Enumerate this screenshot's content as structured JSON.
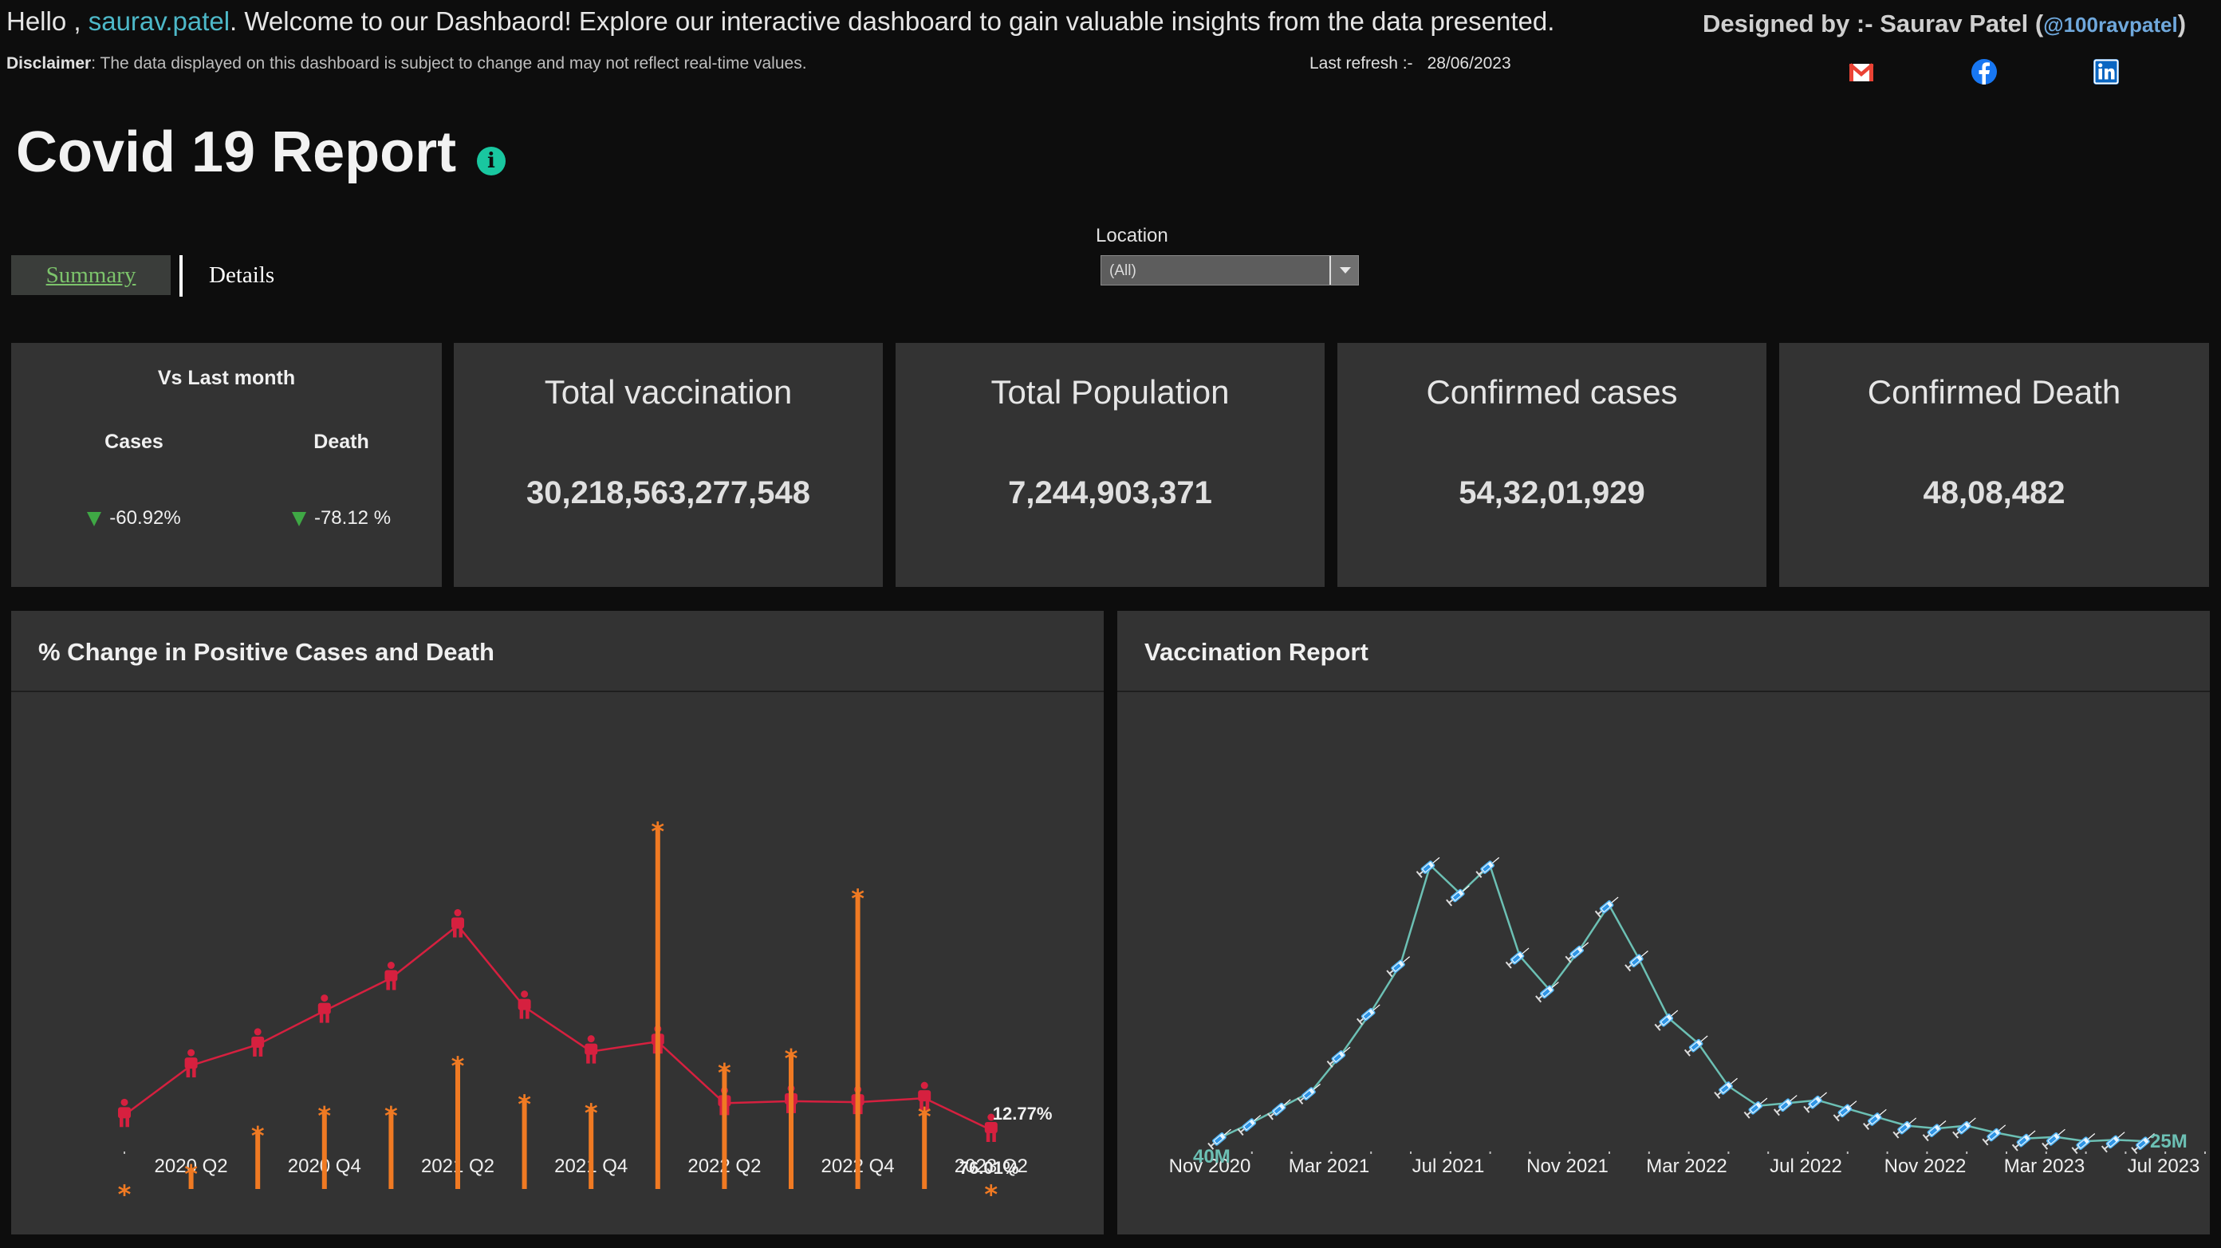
{
  "header": {
    "greeting_prefix": "Hello ,",
    "username": "saurav.patel",
    "greeting_suffix": ".  Welcome to our Dashbaord! Explore our interactive dashboard to gain valuable insights from the data presented.",
    "disclaimer_label": "Disclaimer",
    "disclaimer_text": ": The data displayed on this dashboard is subject to change and may not reflect real-time values.",
    "refresh_label": "Last refresh :-",
    "refresh_date": "28/06/2023",
    "designer_label": "Designed by  :- Saurav Patel (",
    "designer_handle": "@100ravpatel",
    "designer_close": ")",
    "social_icons": [
      "gmail-icon",
      "facebook-icon",
      "linkedin-icon"
    ],
    "colors": {
      "gmail": "#ea4335",
      "facebook": "#1877f2",
      "linkedin": "#0a66c2"
    }
  },
  "title": "Covid 19 Report",
  "info_icon": "i",
  "tabs": [
    {
      "label": "Summary",
      "active": true
    },
    {
      "label": "Details",
      "active": false
    }
  ],
  "filter": {
    "label": "Location",
    "value": "(All)"
  },
  "kpis": {
    "vs_title": "Vs Last month",
    "cases_label": "Cases",
    "death_label": "Death",
    "cases_change": "-60.92%",
    "death_change": "-78.12 %",
    "cards": [
      {
        "title": "Total vaccination",
        "value": "30,218,563,277,548"
      },
      {
        "title": "Total Population",
        "value": "7,244,903,371"
      },
      {
        "title": "Confirmed cases",
        "value": "54,32,01,929"
      },
      {
        "title": "Confirmed Death",
        "value": "48,08,482"
      }
    ]
  },
  "panels": {
    "left_title": "% Change in Positive Cases and Death",
    "right_title": "Vaccination Report"
  },
  "chart_data": [
    {
      "type": "line",
      "title": "% Change in Positive Cases and Death",
      "x": [
        "2020 Q1",
        "2020 Q2",
        "2020 Q3",
        "2020 Q4",
        "2021 Q1",
        "2021 Q2",
        "2021 Q3",
        "2021 Q4",
        "2022 Q1",
        "2022 Q2",
        "2022 Q3",
        "2022 Q4",
        "2023 Q1",
        "2023 Q2"
      ],
      "tick_labels": [
        "2020 Q2",
        "2020 Q4",
        "2021 Q2",
        "2021 Q4",
        "2022 Q2",
        "2022 Q4",
        "2023 Q2"
      ],
      "series": [
        {
          "kind": "line",
          "color": "#d6203f",
          "values": [
            1.5,
            6.5,
            8.6,
            12.0,
            15.3,
            20.6,
            12.4,
            7.9,
            8.9,
            2.7,
            2.9,
            2.8,
            3.2,
            0.0
          ],
          "end_label": "12.77%"
        },
        {
          "kind": "lollipop",
          "color": "#f07a23",
          "values": [
            0.1,
            2.2,
            6.2,
            8.3,
            8.3,
            13.5,
            9.5,
            8.6,
            38.0,
            12.8,
            14.3,
            31.0,
            8.2,
            0.1
          ],
          "end_label": "76.01%"
        }
      ]
    },
    {
      "type": "line",
      "title": "Vaccination Report",
      "x_ticks": [
        "Nov 2020",
        "Mar 2021",
        "Jul 2021",
        "Nov 2021",
        "Mar 2022",
        "Jul 2022",
        "Nov 2022",
        "Mar 2023",
        "Jul 2023"
      ],
      "x": [
        "2020-11",
        "2020-12",
        "2021-01",
        "2021-02",
        "2021-03",
        "2021-04",
        "2021-05",
        "2021-06",
        "2021-07",
        "2021-08",
        "2021-09",
        "2021-10",
        "2021-11",
        "2021-12",
        "2022-01",
        "2022-02",
        "2022-03",
        "2022-04",
        "2022-05",
        "2022-06",
        "2022-07",
        "2022-08",
        "2022-09",
        "2022-10",
        "2022-11",
        "2022-12",
        "2023-01",
        "2023-02",
        "2023-03",
        "2023-04",
        "2023-05",
        "2023-06"
      ],
      "values_millions": [
        40,
        90,
        145,
        200,
        330,
        480,
        650,
        1000,
        900,
        1000,
        680,
        560,
        700,
        860,
        670,
        460,
        370,
        220,
        150,
        160,
        170,
        140,
        110,
        80,
        70,
        80,
        55,
        35,
        40,
        25,
        30,
        25
      ],
      "start_label": "40M",
      "end_label": "25M",
      "color": "#6cc0b4",
      "marker_icon": "syringe-icon"
    }
  ]
}
